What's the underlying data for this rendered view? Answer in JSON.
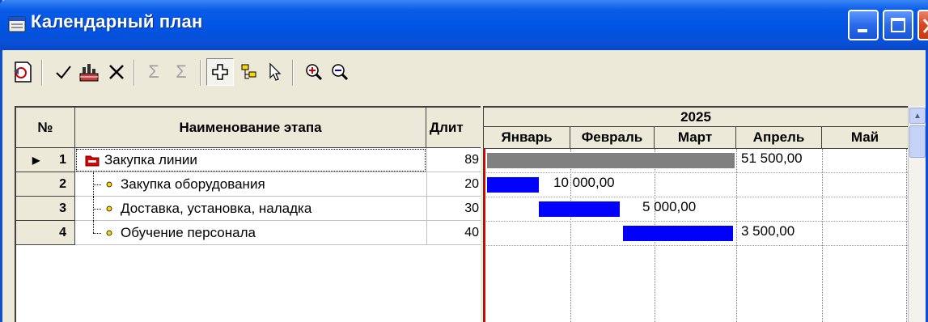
{
  "window": {
    "title": "Календарный план",
    "controls": [
      "minimize-icon",
      "maximize-icon",
      "close-icon"
    ]
  },
  "toolbar": {
    "icons": [
      "exit-doc-icon",
      "check-icon",
      "chart-icon",
      "delete-icon",
      "sum-left-icon",
      "sum-right-icon",
      "add-node-icon",
      "tree-icon",
      "pointer-icon",
      "zoom-in-icon",
      "zoom-out-icon"
    ]
  },
  "grid": {
    "columns": {
      "num": "№",
      "name": "Наименование этапа",
      "duration": "Длит"
    },
    "rows": [
      {
        "num": "1",
        "name": "Закупка линии",
        "duration": "89",
        "type": "folder",
        "selected": true
      },
      {
        "num": "2",
        "name": "Закупка оборудования",
        "duration": "20",
        "type": "task"
      },
      {
        "num": "3",
        "name": "Доставка, установка, наладка",
        "duration": "30",
        "type": "task"
      },
      {
        "num": "4",
        "name": "Обучение персонала",
        "duration": "40",
        "type": "task"
      }
    ]
  },
  "gantt": {
    "year": "2025",
    "months": [
      "Январь",
      "Февраль",
      "Март",
      "Апрель",
      "Май"
    ],
    "bars": [
      {
        "label": "51 500,00",
        "color": "#808080"
      },
      {
        "label": "10 000,00",
        "color": "#0000ff"
      },
      {
        "label": "5 000,00",
        "color": "#0000ff"
      },
      {
        "label": "3 500,00",
        "color": "#0000ff"
      }
    ]
  },
  "colors": {
    "titlebar": "#0054e3",
    "summary_bar": "#808080",
    "task_bar": "#0000ff",
    "today_line": "#e00000"
  }
}
